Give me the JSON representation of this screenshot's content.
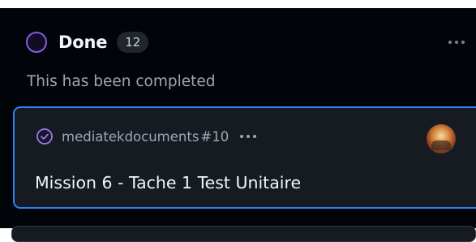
{
  "column": {
    "title": "Done",
    "count": "12",
    "description": "This has been completed",
    "status_icon": "circle-status-icon",
    "more_icon": "kebab-horizontal-icon"
  },
  "card": {
    "repo": "mediatekdocuments",
    "number": "#10",
    "title": "Mission 6 - Tache 1 Test Unitaire",
    "status_icon": "issue-closed-icon",
    "more_icon": "kebab-horizontal-icon",
    "avatar_icon": "user-avatar"
  },
  "colors": {
    "background": "#010409",
    "card_background": "#161b22",
    "selected_border": "#2f81f7",
    "done_purple": "#8957e5",
    "text_primary": "#f0f6fc",
    "text_muted": "#9ea7b3"
  }
}
